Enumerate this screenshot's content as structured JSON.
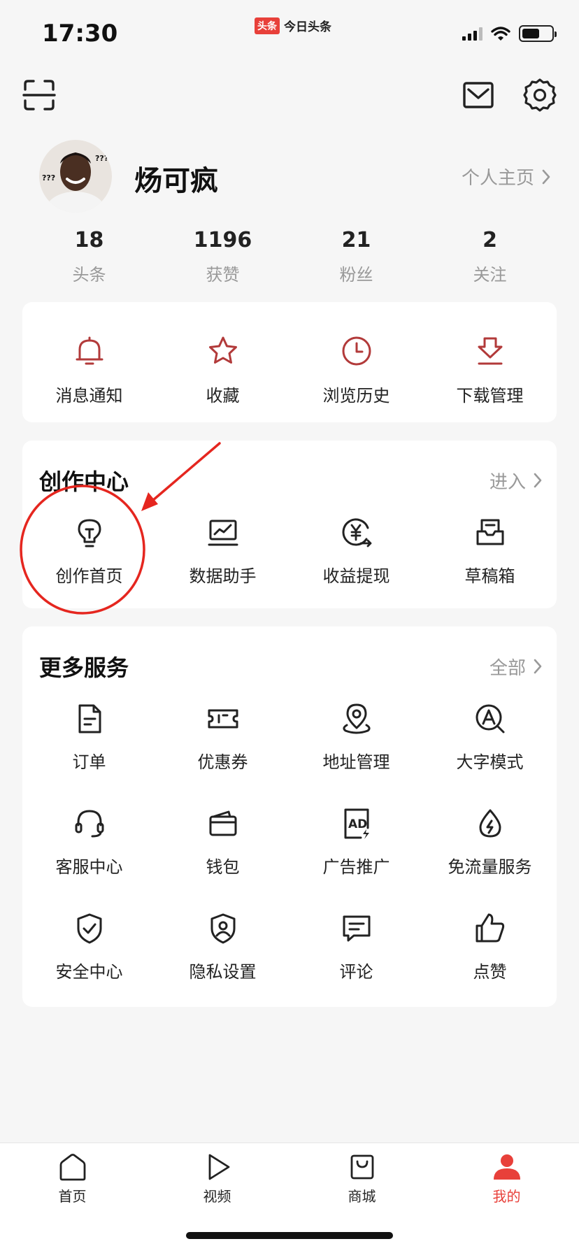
{
  "status_bar": {
    "time": "17:30",
    "app_badge": "头条",
    "app_name": "今日头条"
  },
  "top_actions": {
    "scan_icon": "scan-icon",
    "mail_icon": "mail-icon",
    "settings_icon": "gear-icon"
  },
  "profile": {
    "username": "炀可疯",
    "homepage_link": "个人主页",
    "avatar_text_1": "???",
    "avatar_text_2": "???"
  },
  "stats": [
    {
      "value": "18",
      "label": "头条"
    },
    {
      "value": "1196",
      "label": "获赞"
    },
    {
      "value": "21",
      "label": "粉丝"
    },
    {
      "value": "2",
      "label": "关注"
    }
  ],
  "quick_actions": [
    {
      "label": "消息通知",
      "icon": "bell-icon"
    },
    {
      "label": "收藏",
      "icon": "star-icon"
    },
    {
      "label": "浏览历史",
      "icon": "clock-icon"
    },
    {
      "label": "下载管理",
      "icon": "download-icon"
    }
  ],
  "creation_center": {
    "title": "创作中心",
    "more": "进入",
    "items": [
      {
        "label": "创作首页",
        "icon": "lightbulb-icon"
      },
      {
        "label": "数据助手",
        "icon": "chart-icon"
      },
      {
        "label": "收益提现",
        "icon": "yuan-withdraw-icon"
      },
      {
        "label": "草稿箱",
        "icon": "draft-box-icon"
      }
    ]
  },
  "more_services": {
    "title": "更多服务",
    "more": "全部",
    "items": [
      {
        "label": "订单",
        "icon": "order-icon"
      },
      {
        "label": "优惠券",
        "icon": "coupon-icon"
      },
      {
        "label": "地址管理",
        "icon": "location-icon"
      },
      {
        "label": "大字模式",
        "icon": "large-font-icon"
      },
      {
        "label": "客服中心",
        "icon": "headset-icon"
      },
      {
        "label": "钱包",
        "icon": "wallet-icon"
      },
      {
        "label": "广告推广",
        "icon": "ad-icon"
      },
      {
        "label": "免流量服务",
        "icon": "data-free-icon"
      },
      {
        "label": "安全中心",
        "icon": "shield-check-icon"
      },
      {
        "label": "隐私设置",
        "icon": "privacy-icon"
      },
      {
        "label": "评论",
        "icon": "comment-icon"
      },
      {
        "label": "点赞",
        "icon": "thumbs-up-icon"
      }
    ]
  },
  "tabbar": [
    {
      "label": "首页",
      "icon": "home-icon",
      "active": false
    },
    {
      "label": "视频",
      "icon": "play-icon",
      "active": false
    },
    {
      "label": "商城",
      "icon": "shopping-bag-icon",
      "active": false
    },
    {
      "label": "我的",
      "icon": "user-icon",
      "active": true
    }
  ],
  "colors": {
    "accent": "#e8403a",
    "icon_red": "#b23a3a",
    "annotation_red": "#e5261f"
  }
}
